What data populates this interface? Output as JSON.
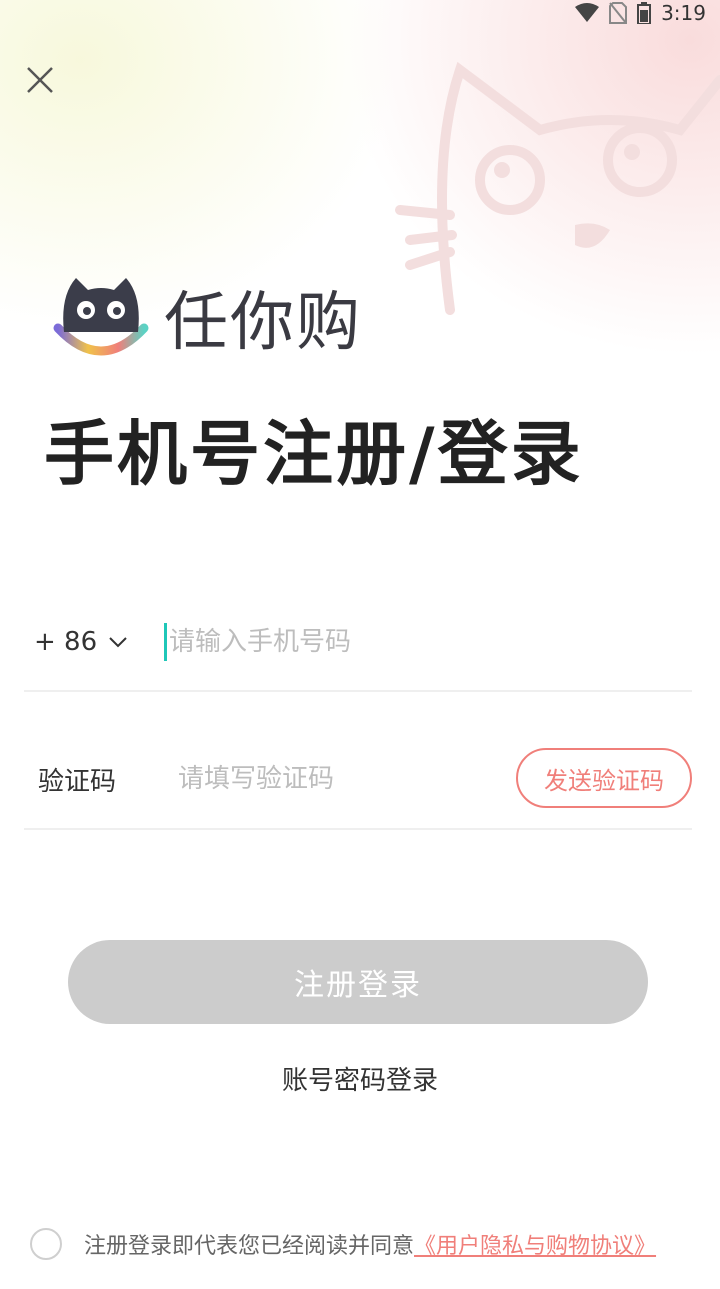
{
  "status_bar": {
    "time": "3:19"
  },
  "brand": {
    "name": "任你购"
  },
  "title": "手机号注册/登录",
  "phone": {
    "country_code": "+ 86",
    "placeholder": "请输入手机号码",
    "value": ""
  },
  "code": {
    "label": "验证码",
    "placeholder": "请填写验证码",
    "value": "",
    "send_label": "发送验证码"
  },
  "submit_label": "注册登录",
  "alt_login_label": "账号密码登录",
  "agreement": {
    "text": "注册登录即代表您已经阅读并同意",
    "link": "《用户隐私与购物协议》",
    "checked": false
  },
  "colors": {
    "accent": "#f07f7a",
    "cursor": "#1fc7b8",
    "disabled_button": "#cccccc"
  }
}
